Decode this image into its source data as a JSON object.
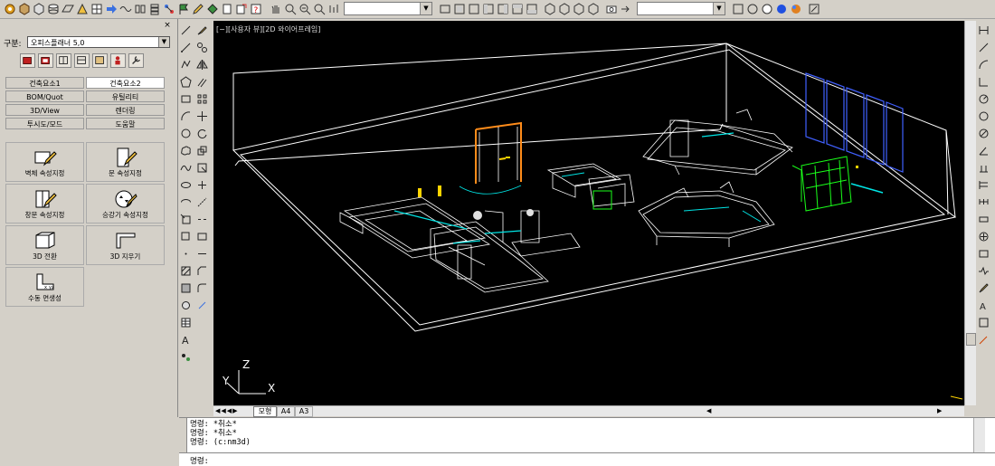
{
  "panel": {
    "label_gubun": "구분:",
    "selected_product": "오피스플래너 5,0",
    "menu": [
      [
        "건축요소1",
        "건축요소2"
      ],
      [
        "BOM/Quot",
        "유틸리티"
      ],
      [
        "3D/View",
        "렌더링"
      ],
      [
        "투시도/모드",
        "도움말"
      ]
    ],
    "active_menu": "건축요소2",
    "tools": {
      "wall": "벽체 속성지정",
      "door": "문 속성지정",
      "window": "창문 속성지정",
      "elevator": "승강기 속성지정",
      "to3d": "3D 전환",
      "erase3d": "3D 지우기",
      "sidesurf": "수동 면생성"
    },
    "close": "×"
  },
  "viewport": {
    "label": "[−][사용자 뷰][2D 와이어프레임]",
    "axis_x": "X",
    "axis_y": "Y",
    "axis_z": "Z"
  },
  "tabs": {
    "model": "모형",
    "a4": "A4",
    "a3": "A3"
  },
  "command": {
    "lines": [
      "명령: *취소*",
      "명령: *취소*",
      "명령: (c:nm3d)"
    ],
    "prompt": "명령:"
  },
  "colors": {
    "viewport_bg": "#000000",
    "wire": "#ffffff",
    "accent_cyan": "#00e5e5",
    "accent_green": "#1aff1a",
    "accent_orange": "#ff8c1a",
    "accent_blue": "#4060ff",
    "accent_yellow": "#ffd400"
  }
}
